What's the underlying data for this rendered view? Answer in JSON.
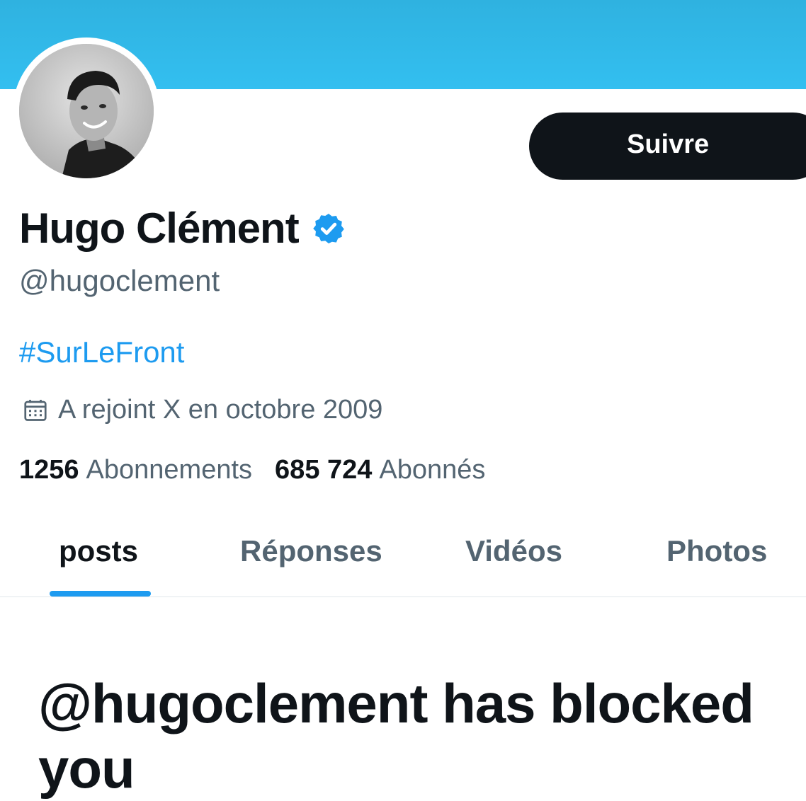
{
  "profile": {
    "name": "Hugo Clément",
    "handle": "@hugoclement",
    "bio": "#SurLeFront",
    "joined": "A rejoint X en octobre 2009",
    "verified": true
  },
  "actions": {
    "follow_label": "Suivre"
  },
  "stats": {
    "following_count": "1256",
    "following_label": "Abonnements",
    "followers_count": "685 724",
    "followers_label": "Abonnés"
  },
  "tabs": [
    {
      "label": "posts",
      "active": true
    },
    {
      "label": "Réponses",
      "active": false
    },
    {
      "label": "Vidéos",
      "active": false
    },
    {
      "label": "Photos",
      "active": false
    }
  ],
  "main": {
    "blocked_message": "@hugoclement has blocked you"
  },
  "colors": {
    "banner": "#33bff0",
    "accent": "#1d9bf0",
    "text_primary": "#0f1419",
    "text_secondary": "#536471",
    "button_bg": "#0f1419"
  },
  "icons": [
    "verified-badge-icon",
    "calendar-icon"
  ]
}
